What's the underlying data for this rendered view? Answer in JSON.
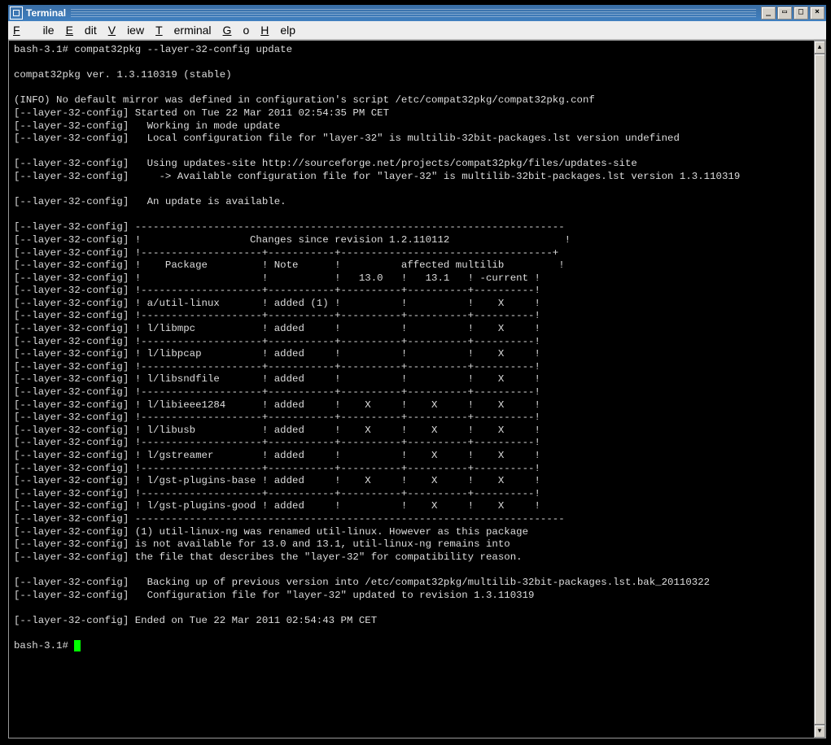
{
  "window": {
    "title": "Terminal"
  },
  "menubar": {
    "file": "File",
    "edit": "Edit",
    "view": "View",
    "terminal": "Terminal",
    "go": "Go",
    "help": "Help"
  },
  "winbuttons": {
    "min": "_",
    "max": "□",
    "restore": "▭",
    "close": "×"
  },
  "terminal": {
    "prompt1": "bash-3.1# ",
    "command": "compat32pkg --layer-32-config update",
    "blank": "",
    "version": "compat32pkg ver. 1.3.110319 (stable)",
    "info": "(INFO) No default mirror was defined in configuration's script /etc/compat32pkg/compat32pkg.conf",
    "l01": "[--layer-32-config] Started on Tue 22 Mar 2011 02:54:35 PM CET",
    "l02": "[--layer-32-config]   Working in mode update",
    "l03": "[--layer-32-config]   Local configuration file for \"layer-32\" is multilib-32bit-packages.lst version undefined",
    "l04": "[--layer-32-config]   Using updates-site http://sourceforge.net/projects/compat32pkg/files/updates-site",
    "l05": "[--layer-32-config]     -> Available configuration file for \"layer-32\" is multilib-32bit-packages.lst version 1.3.110319",
    "l06": "[--layer-32-config]   An update is available.",
    "l07": "[--layer-32-config] -----------------------------------------------------------------------",
    "l08": "[--layer-32-config] !                  Changes since revision 1.2.110112                   !",
    "l09": "[--layer-32-config] !--------------------+-----------+-----------------------------------+",
    "l10": "[--layer-32-config] !    Package         ! Note      !          affected multilib         !",
    "l11": "[--layer-32-config] !                    !           !   13.0   !   13.1   ! -current !",
    "l12": "[--layer-32-config] !--------------------+-----------+----------+----------+----------!",
    "l13": "[--layer-32-config] ! a/util-linux       ! added (1) !          !          !    X     !",
    "l14": "[--layer-32-config] !--------------------+-----------+----------+----------+----------!",
    "l15": "[--layer-32-config] ! l/libmpc           ! added     !          !          !    X     !",
    "l16": "[--layer-32-config] !--------------------+-----------+----------+----------+----------!",
    "l17": "[--layer-32-config] ! l/libpcap          ! added     !          !          !    X     !",
    "l18": "[--layer-32-config] !--------------------+-----------+----------+----------+----------!",
    "l19": "[--layer-32-config] ! l/libsndfile       ! added     !          !          !    X     !",
    "l20": "[--layer-32-config] !--------------------+-----------+----------+----------+----------!",
    "l21": "[--layer-32-config] ! l/libieee1284      ! added     !    X     !    X     !    X     !",
    "l22": "[--layer-32-config] !--------------------+-----------+----------+----------+----------!",
    "l23": "[--layer-32-config] ! l/libusb           ! added     !    X     !    X     !    X     !",
    "l24": "[--layer-32-config] !--------------------+-----------+----------+----------+----------!",
    "l25": "[--layer-32-config] ! l/gstreamer        ! added     !          !    X     !    X     !",
    "l26": "[--layer-32-config] !--------------------+-----------+----------+----------+----------!",
    "l27": "[--layer-32-config] ! l/gst-plugins-base ! added     !    X     !    X     !    X     !",
    "l28": "[--layer-32-config] !--------------------+-----------+----------+----------+----------!",
    "l29": "[--layer-32-config] ! l/gst-plugins-good ! added     !          !    X     !    X     !",
    "l30": "[--layer-32-config] -----------------------------------------------------------------------",
    "l31": "[--layer-32-config] (1) util-linux-ng was renamed util-linux. However as this package",
    "l32": "[--layer-32-config] is not available for 13.0 and 13.1, util-linux-ng remains into",
    "l33": "[--layer-32-config] the file that describes the \"layer-32\" for compatibility reason.",
    "l34": "[--layer-32-config]   Backing up of previous version into /etc/compat32pkg/multilib-32bit-packages.lst.bak_20110322",
    "l35": "[--layer-32-config]   Configuration file for \"layer-32\" updated to revision 1.3.110319",
    "l36": "[--layer-32-config] Ended on Tue 22 Mar 2011 02:54:43 PM CET",
    "prompt2": "bash-3.1# "
  }
}
